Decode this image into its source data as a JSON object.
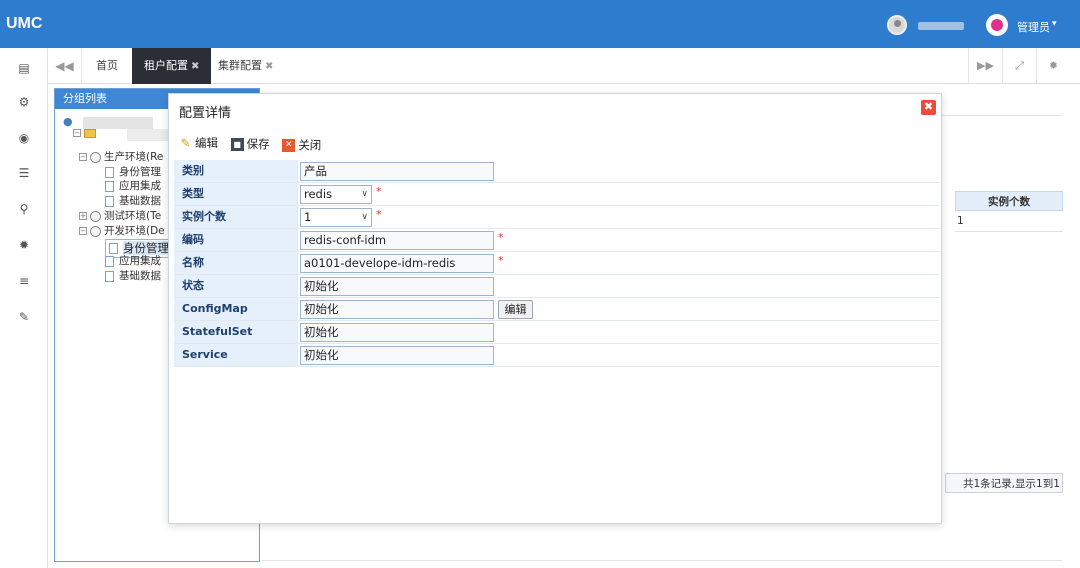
{
  "app": {
    "logo": "UMC"
  },
  "header": {
    "admin_label": "管理员",
    "admin_caret": "▾"
  },
  "rail": {
    "items": [
      {
        "icon": "id-card-icon",
        "glyph": "▤"
      },
      {
        "icon": "gears-icon",
        "glyph": "⚙"
      },
      {
        "icon": "eye-icon",
        "glyph": "◉"
      },
      {
        "icon": "list-icon",
        "glyph": "☰"
      },
      {
        "icon": "sitemap-icon",
        "glyph": "⚲"
      },
      {
        "icon": "gear-icon",
        "glyph": "✹"
      },
      {
        "icon": "menu-icon",
        "glyph": "≡"
      },
      {
        "icon": "wrench-icon",
        "glyph": "✎"
      }
    ]
  },
  "tabs": {
    "nav_left": "◀◀",
    "items": [
      {
        "label": "首页",
        "closable": false,
        "active": false
      },
      {
        "label": "租户配置",
        "closable": true,
        "active": true
      },
      {
        "label": "集群配置",
        "closable": true,
        "active": false
      }
    ],
    "close_glyph": "✖",
    "right_controls": [
      "▶▶",
      "⤢",
      "✹"
    ]
  },
  "group_panel": {
    "title": "分组列表",
    "tree": [
      {
        "label": "生产环境(Re",
        "kind": "env"
      },
      {
        "label": "身份管理",
        "kind": "doc"
      },
      {
        "label": "应用集成",
        "kind": "doc"
      },
      {
        "label": "基础数据",
        "kind": "doc"
      },
      {
        "label": "测试环境(Te",
        "kind": "env"
      },
      {
        "label": "开发环境(De",
        "kind": "env"
      },
      {
        "label": "身份管理",
        "kind": "doc",
        "selected": true
      },
      {
        "label": "应用集成",
        "kind": "doc"
      },
      {
        "label": "基础数据",
        "kind": "doc"
      }
    ]
  },
  "background_grid": {
    "column_header": "实例个数",
    "value": "1",
    "footer": "共1条记录,显示1到1"
  },
  "dialog": {
    "title": "配置详情",
    "close_glyph": "✖",
    "toolbar": {
      "edit": "编辑",
      "save": "保存",
      "close": "关闭"
    },
    "fields": [
      {
        "label": "类别",
        "value": "产品",
        "kind": "input"
      },
      {
        "label": "类型",
        "value": "redis",
        "kind": "select",
        "required": true
      },
      {
        "label": "实例个数",
        "value": "1",
        "kind": "select",
        "required": true
      },
      {
        "label": "编码",
        "value": "redis-conf-idm",
        "kind": "input",
        "required": true
      },
      {
        "label": "名称",
        "value": "a0101-develope-idm-redis",
        "kind": "input",
        "required": true
      },
      {
        "label": "状态",
        "value": "初始化",
        "kind": "input"
      },
      {
        "label": "ConfigMap",
        "value": "初始化",
        "kind": "input",
        "button": "编辑"
      },
      {
        "label": "StatefulSet",
        "value": "初始化",
        "kind": "input"
      },
      {
        "label": "Service",
        "value": "初始化",
        "kind": "input"
      }
    ],
    "required_mark": "*",
    "select_arrow": "∨"
  },
  "colors": {
    "topbar": "#2e7ccd",
    "active_tab": "#2b2f35",
    "label_bg": "#e6f0fb",
    "close_red": "#e74c3c"
  }
}
